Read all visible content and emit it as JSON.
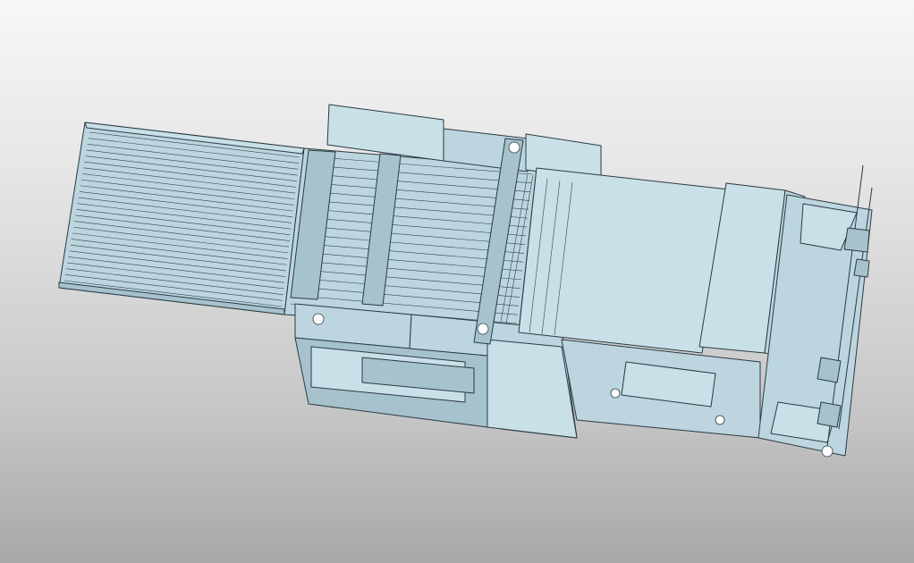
{
  "viewport": {
    "background_top": "#f7f7f7",
    "background_bottom": "#a8a8a8",
    "part_color": "#bcd5df",
    "edge_color": "#2b3a42"
  },
  "model": {
    "conveyor_roller_count": 26,
    "icon": "cad-assembly-machine"
  }
}
